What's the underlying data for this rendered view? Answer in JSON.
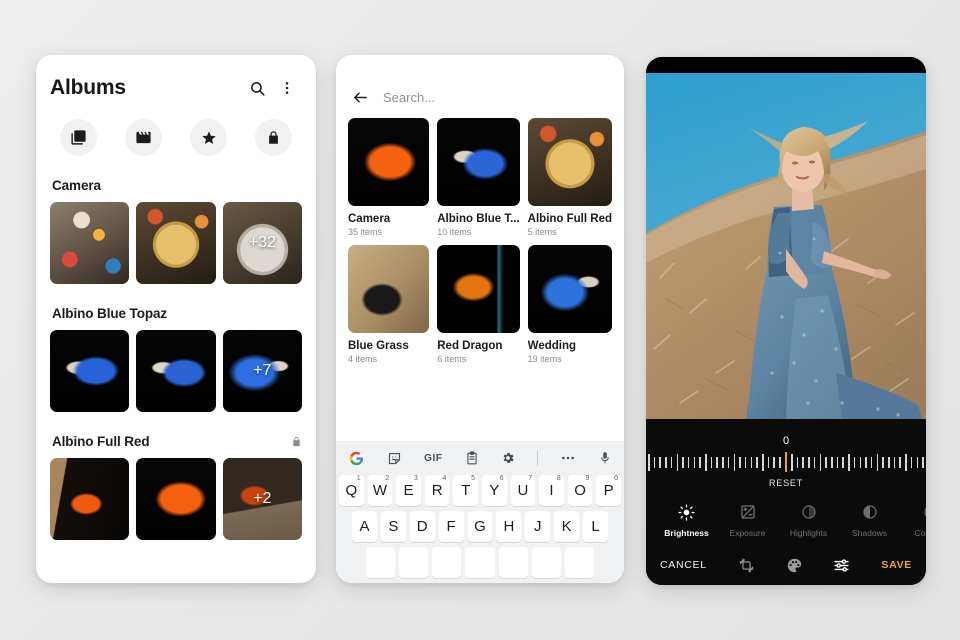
{
  "background": "#e9e9e9",
  "albums_screen": {
    "title": "Albums",
    "search_icon": "search-icon",
    "overflow_icon": "more-vert-icon",
    "chips": [
      {
        "name": "photos",
        "icon": "photo-library-icon"
      },
      {
        "name": "videos",
        "icon": "movie-icon"
      },
      {
        "name": "favorites",
        "icon": "star-icon"
      },
      {
        "name": "locked",
        "icon": "lock-icon"
      }
    ],
    "sections": [
      {
        "title": "Camera",
        "locked": false,
        "thumbs": [
          {
            "alt": "market-stall-photo",
            "badge": ""
          },
          {
            "alt": "noodle-platter-photo",
            "badge": ""
          },
          {
            "alt": "soup-bowl-photo",
            "badge": "+32"
          }
        ]
      },
      {
        "title": "Albino Blue Topaz",
        "locked": false,
        "thumbs": [
          {
            "alt": "blue-guppy-photo-1",
            "badge": ""
          },
          {
            "alt": "blue-guppy-photo-2",
            "badge": ""
          },
          {
            "alt": "blue-guppy-photo-3",
            "badge": "+7"
          }
        ]
      },
      {
        "title": "Albino Full Red",
        "locked": true,
        "lock_icon": "lock-icon",
        "thumbs": [
          {
            "alt": "red-guppy-photo-1",
            "badge": ""
          },
          {
            "alt": "red-guppy-photo-2",
            "badge": ""
          },
          {
            "alt": "red-guppy-photo-3",
            "badge": "+2"
          }
        ]
      }
    ]
  },
  "search_screen": {
    "back_icon": "arrow-back-icon",
    "search_placeholder": "Search...",
    "search_value": "",
    "albums": [
      {
        "name": "Camera",
        "count": "35 items",
        "alt": "orange-guppy-photo"
      },
      {
        "name": "Albino Blue T...",
        "count": "10 items",
        "alt": "blue-guppy-photo"
      },
      {
        "name": "Albino Full Red",
        "count": "5 items",
        "alt": "noodle-platter-photo"
      },
      {
        "name": "Blue Grass",
        "count": "4 items",
        "alt": "person-tshirt-field-photo"
      },
      {
        "name": "Red Dragon",
        "count": "6 items",
        "alt": "red-dragon-guppy-photo"
      },
      {
        "name": "Wedding",
        "count": "19 items",
        "alt": "blue-wedding-guppy-photo"
      }
    ],
    "keyboard": {
      "toolbar": [
        {
          "name": "google-logo",
          "label": "G"
        },
        {
          "name": "sticker-icon",
          "label": ""
        },
        {
          "name": "gif-icon",
          "label": "GIF"
        },
        {
          "name": "clipboard-icon",
          "label": ""
        },
        {
          "name": "settings-gear-icon",
          "label": ""
        },
        {
          "name": "divider",
          "label": ""
        },
        {
          "name": "overflow-dots-icon",
          "label": ""
        },
        {
          "name": "microphone-icon",
          "label": ""
        }
      ],
      "row1": [
        {
          "key": "Q",
          "num": "1"
        },
        {
          "key": "W",
          "num": "2"
        },
        {
          "key": "E",
          "num": "3"
        },
        {
          "key": "R",
          "num": "4"
        },
        {
          "key": "T",
          "num": "5"
        },
        {
          "key": "Y",
          "num": "6"
        },
        {
          "key": "U",
          "num": "7"
        },
        {
          "key": "I",
          "num": "8"
        },
        {
          "key": "O",
          "num": "9"
        },
        {
          "key": "P",
          "num": "0"
        }
      ],
      "row2": [
        {
          "key": "A",
          "num": ""
        },
        {
          "key": "S",
          "num": ""
        },
        {
          "key": "D",
          "num": ""
        },
        {
          "key": "F",
          "num": ""
        },
        {
          "key": "G",
          "num": ""
        },
        {
          "key": "H",
          "num": ""
        },
        {
          "key": "J",
          "num": ""
        },
        {
          "key": "K",
          "num": ""
        },
        {
          "key": "L",
          "num": ""
        }
      ],
      "row3": [
        {
          "key": "",
          "num": ""
        },
        {
          "key": "",
          "num": ""
        },
        {
          "key": "",
          "num": ""
        },
        {
          "key": "",
          "num": ""
        },
        {
          "key": "",
          "num": ""
        },
        {
          "key": "",
          "num": ""
        },
        {
          "key": "",
          "num": ""
        }
      ]
    }
  },
  "editor_screen": {
    "photo_alt": "woman-in-blue-dress-in-dry-grass-field",
    "slider": {
      "value": "0",
      "reset_label": "RESET",
      "accent_color": "#e8a33d",
      "tick_count": 49,
      "center_index": 24
    },
    "filters": [
      {
        "label": "Brightness",
        "icon": "brightness-icon",
        "active": true
      },
      {
        "label": "Exposure",
        "icon": "exposure-icon",
        "active": false
      },
      {
        "label": "Highlights",
        "icon": "highlights-icon",
        "active": false
      },
      {
        "label": "Shadows",
        "icon": "shadows-icon",
        "active": false
      },
      {
        "label": "Contrast",
        "icon": "contrast-icon",
        "active": false
      }
    ],
    "bottom_bar": {
      "cancel_label": "CANCEL",
      "crop_icon": "crop-rotate-icon",
      "filter_icon": "palette-icon",
      "tune_icon": "tune-sliders-icon",
      "save_label": "SAVE",
      "save_color": "#e9a83e"
    }
  }
}
